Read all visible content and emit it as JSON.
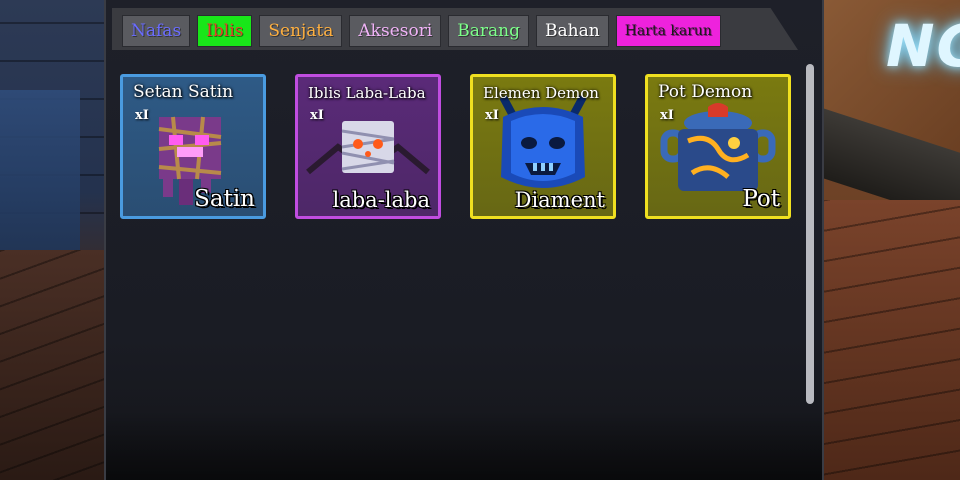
{
  "scene": {
    "sign_text": "NG"
  },
  "tabs": [
    {
      "label": "Nafas",
      "color": "#6a6cff",
      "bg": "#5a5b60"
    },
    {
      "label": "Iblis",
      "color": "#e0402a",
      "bg": "#19e619"
    },
    {
      "label": "Senjata",
      "color": "#ffb040",
      "bg": "#5a5b60"
    },
    {
      "label": "Aksesori",
      "color": "#f0b3f7",
      "bg": "#5a5b60"
    },
    {
      "label": "Barang",
      "color": "#7dff8a",
      "bg": "#5a5b60"
    },
    {
      "label": "Bahan",
      "color": "#ffffff",
      "bg": "#5a5b60"
    },
    {
      "label": "Harta karun",
      "color": "#1a1a1a",
      "bg": "#ee22dd"
    }
  ],
  "items": [
    {
      "title": "Setan Satin",
      "count": "xI",
      "label": "Satin",
      "bg": "#2e5a86",
      "border": "#4a9be0",
      "icon": "satin-demon-icon"
    },
    {
      "title": "Iblis Laba-Laba",
      "count": "xI",
      "label": "laba-laba",
      "bg": "#5a2a78",
      "border": "#c04de0",
      "icon": "spider-demon-icon"
    },
    {
      "title": "Elemen Demon",
      "count": "xI",
      "label": "Diament",
      "bg": "#7a7a10",
      "border": "#f0e020",
      "icon": "element-demon-icon"
    },
    {
      "title": "Pot Demon",
      "count": "xI",
      "label": "Pot",
      "bg": "#7a7a10",
      "border": "#f0e020",
      "icon": "pot-demon-icon"
    }
  ]
}
